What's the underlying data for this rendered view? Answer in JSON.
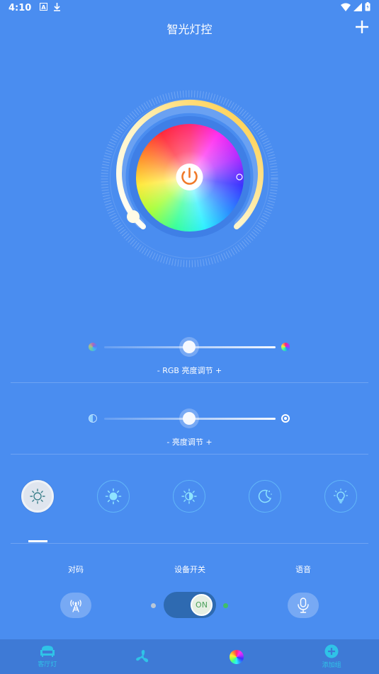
{
  "status_bar": {
    "time": "4:10"
  },
  "header": {
    "title": "智光灯控",
    "add_icon": "plus-icon"
  },
  "sliders": [
    {
      "label": "- RGB 亮度调节 +",
      "value": 0.5
    },
    {
      "label": "- 亮度调节 +",
      "value": 0.5
    }
  ],
  "modes": [
    {
      "icon": "sun-outline-icon",
      "active": true
    },
    {
      "icon": "sun-bright-icon",
      "active": false
    },
    {
      "icon": "sun-dim-icon",
      "active": false
    },
    {
      "icon": "moon-icon",
      "active": false
    },
    {
      "icon": "bulb-icon",
      "active": false
    }
  ],
  "controls": {
    "pair_label": "对码",
    "switch_label": "设备开关",
    "voice_label": "语音",
    "toggle_text": "ON"
  },
  "nav": [
    {
      "label": "客厅灯",
      "icon": "sofa-icon"
    },
    {
      "label": "",
      "icon": "fan-icon"
    },
    {
      "label": "",
      "icon": "color-wheel-icon"
    },
    {
      "label": "添加组",
      "icon": "add-circle-icon"
    }
  ],
  "colors": {
    "background": "#4a8df0",
    "accent_yellow": "#ffd23f",
    "nav_bg": "#3e7ad6",
    "power": "#f07a2a"
  }
}
